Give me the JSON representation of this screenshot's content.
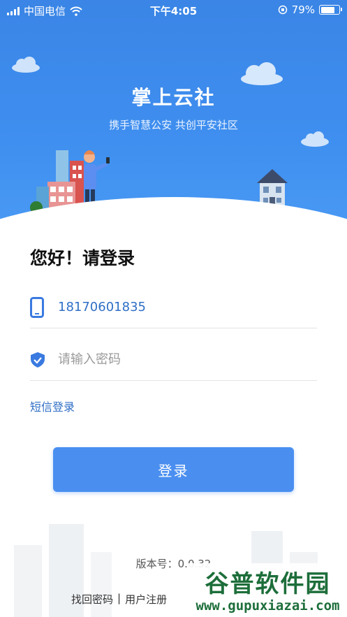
{
  "status_bar": {
    "carrier": "中国电信",
    "time": "下午4:05",
    "battery": "79%",
    "battery_level": 0.79
  },
  "header": {
    "title": "掌上云社",
    "slogan": "携手智慧公安 共创平安社区"
  },
  "login": {
    "greeting": "您好！请登录",
    "phone_value": "18170601835",
    "password_placeholder": "请输入密码",
    "sms_login_link": "短信登录",
    "login_button": "登录"
  },
  "footer": {
    "version": "版本号：0.0.32",
    "links": [
      "找回密码",
      "|",
      "用户注册"
    ]
  },
  "watermark": {
    "title": "谷普软件园",
    "url": "www.gupuxiazai.com"
  },
  "colors": {
    "header_blue": "#3f8ff0",
    "link_blue": "#2f6fc6",
    "button_blue": "#4a8ff0",
    "watermark_green": "#1d6e3a"
  }
}
